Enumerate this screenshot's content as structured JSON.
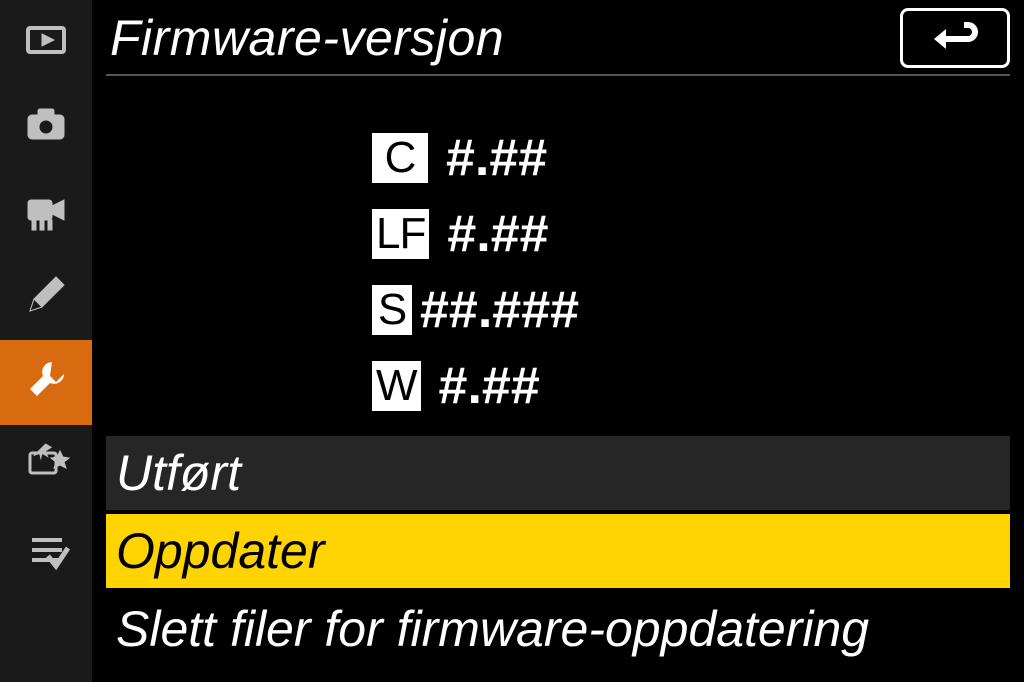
{
  "header": {
    "title": "Firmware-versjon"
  },
  "versions": [
    {
      "label": "C",
      "value": "#.##"
    },
    {
      "label": "LF",
      "value": "#.##"
    },
    {
      "label": "S",
      "value": "##.###"
    },
    {
      "label": "W",
      "value": "#.##"
    }
  ],
  "options": {
    "done": "Utført",
    "update": "Oppdater",
    "delete": "Slett filer for firmware-oppdatering"
  },
  "sidebar": {
    "items": [
      {
        "name": "playback"
      },
      {
        "name": "photo"
      },
      {
        "name": "video"
      },
      {
        "name": "pencil"
      },
      {
        "name": "wrench"
      },
      {
        "name": "retouch"
      },
      {
        "name": "mymenu"
      }
    ]
  }
}
